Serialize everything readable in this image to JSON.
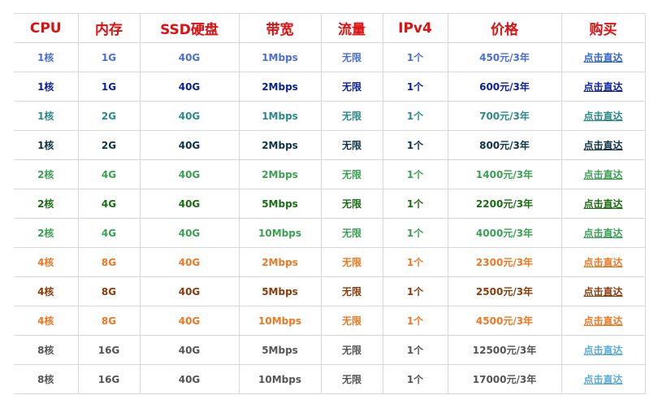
{
  "table": {
    "headers": [
      "CPU",
      "内存",
      "SSD硬盘",
      "带宽",
      "流量",
      "IPv4",
      "价格",
      "购买"
    ],
    "rows": [
      {
        "cpu": "1核",
        "ram": "1G",
        "ssd": "40G",
        "bandwidth": "1Mbps",
        "traffic": "无限",
        "ipv4": "1个",
        "price": "450元/3年",
        "buy": "点击直达",
        "color": "#4a6fd0",
        "link_color": "#3366cc"
      },
      {
        "cpu": "1核",
        "ram": "1G",
        "ssd": "40G",
        "bandwidth": "2Mbps",
        "traffic": "无限",
        "ipv4": "1个",
        "price": "600元/3年",
        "buy": "点击直达",
        "color": "#0a1f9e",
        "link_color": "#0a1f9e"
      },
      {
        "cpu": "1核",
        "ram": "2G",
        "ssd": "40G",
        "bandwidth": "1Mbps",
        "traffic": "无限",
        "ipv4": "1个",
        "price": "700元/3年",
        "buy": "点击直达",
        "color": "#2a8a88",
        "link_color": "#2a8a88"
      },
      {
        "cpu": "1核",
        "ram": "2G",
        "ssd": "40G",
        "bandwidth": "2Mbps",
        "traffic": "无限",
        "ipv4": "1个",
        "price": "800元/3年",
        "buy": "点击直达",
        "color": "#0c3346",
        "link_color": "#0c3346"
      },
      {
        "cpu": "2核",
        "ram": "4G",
        "ssd": "40G",
        "bandwidth": "2Mbps",
        "traffic": "无限",
        "ipv4": "1个",
        "price": "1400元/3年",
        "buy": "点击直达",
        "color": "#3aa052",
        "link_color": "#3aa052"
      },
      {
        "cpu": "2核",
        "ram": "4G",
        "ssd": "40G",
        "bandwidth": "5Mbps",
        "traffic": "无限",
        "ipv4": "1个",
        "price": "2200元/3年",
        "buy": "点击直达",
        "color": "#1a6e12",
        "link_color": "#1a6e12"
      },
      {
        "cpu": "2核",
        "ram": "4G",
        "ssd": "40G",
        "bandwidth": "10Mbps",
        "traffic": "无限",
        "ipv4": "1个",
        "price": "4000元/3年",
        "buy": "点击直达",
        "color": "#3aa052",
        "link_color": "#3aa052"
      },
      {
        "cpu": "4核",
        "ram": "8G",
        "ssd": "40G",
        "bandwidth": "2Mbps",
        "traffic": "无限",
        "ipv4": "1个",
        "price": "2300元/3年",
        "buy": "点击直达",
        "color": "#ee7722",
        "link_color": "#ee7722"
      },
      {
        "cpu": "4核",
        "ram": "8G",
        "ssd": "40G",
        "bandwidth": "5Mbps",
        "traffic": "无限",
        "ipv4": "1个",
        "price": "2500元/3年",
        "buy": "点击直达",
        "color": "#8a3b0a",
        "link_color": "#8a3b0a"
      },
      {
        "cpu": "4核",
        "ram": "8G",
        "ssd": "40G",
        "bandwidth": "10Mbps",
        "traffic": "无限",
        "ipv4": "1个",
        "price": "4500元/3年",
        "buy": "点击直达",
        "color": "#ee7722",
        "link_color": "#ee7722"
      },
      {
        "cpu": "8核",
        "ram": "16G",
        "ssd": "40G",
        "bandwidth": "5Mbps",
        "traffic": "无限",
        "ipv4": "1个",
        "price": "12500元/3年",
        "buy": "点击直达",
        "color": "#555555",
        "link_color": "#5aaad8"
      },
      {
        "cpu": "8核",
        "ram": "16G",
        "ssd": "40G",
        "bandwidth": "10Mbps",
        "traffic": "无限",
        "ipv4": "1个",
        "price": "17000元/3年",
        "buy": "点击直达",
        "color": "#555555",
        "link_color": "#5aaad8"
      }
    ]
  }
}
